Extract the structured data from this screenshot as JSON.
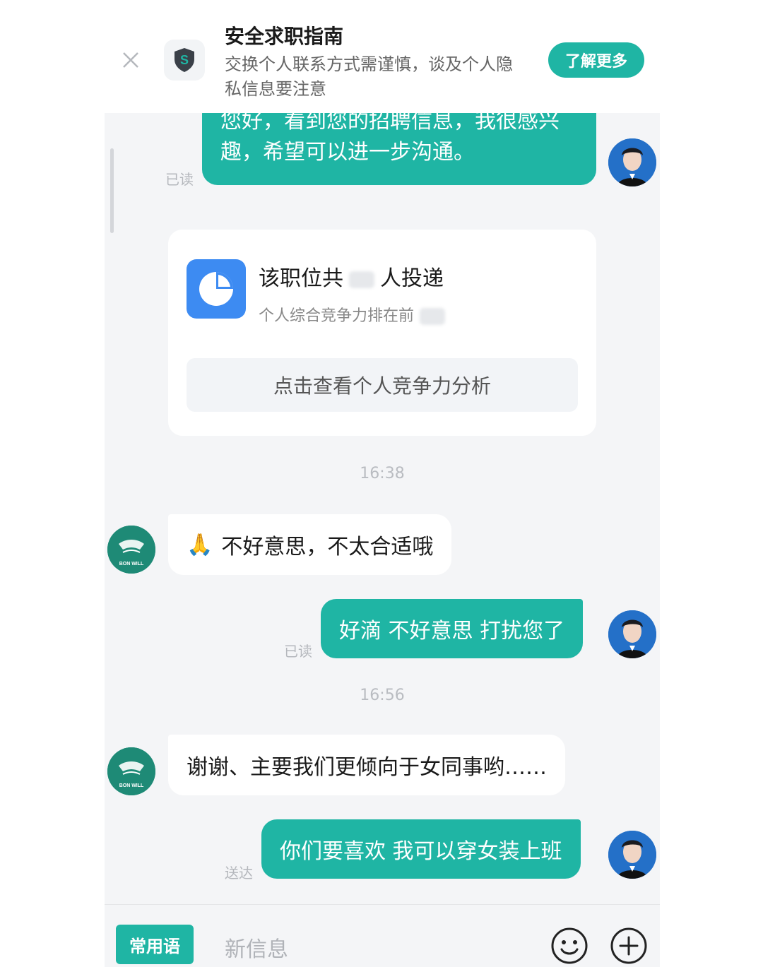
{
  "banner": {
    "title": "安全求职指南",
    "description": "交换个人联系方式需谨慎，谈及个人隐私信息要注意",
    "learn_more": "了解更多",
    "close_icon": "close-icon",
    "shield_icon": "shield-icon"
  },
  "messages": {
    "m1": {
      "text_line1": "您好，看到您的招聘信息，我很感兴",
      "text_line2": "趣，希望可以进一步沟通。",
      "status": "已读"
    },
    "card": {
      "title_prefix": "该职位共",
      "title_suffix": "人投递",
      "subtitle": "个人综合竞争力排在前",
      "button": "点击查看个人竞争力分析"
    },
    "time1": "16:38",
    "m2": {
      "emoji": "🙏",
      "text": "不好意思，不太合适哦"
    },
    "m3": {
      "text": "好滴 不好意思 打扰您了",
      "status": "已读"
    },
    "time2": "16:56",
    "m4": {
      "text": "谢谢、主要我们更倾向于女同事哟……"
    },
    "m5": {
      "text": "你们要喜欢 我可以穿女装上班",
      "status": "送达"
    }
  },
  "hr_avatar_text": "BON WILL",
  "input_bar": {
    "quick_phrases": "常用语",
    "placeholder": "新信息",
    "emoji_icon": "smile-icon",
    "plus_icon": "plus-icon"
  },
  "colors": {
    "accent": "#1fb5a4",
    "chat_bg": "#f4f5f7",
    "card_icon": "#3d8bf2"
  }
}
